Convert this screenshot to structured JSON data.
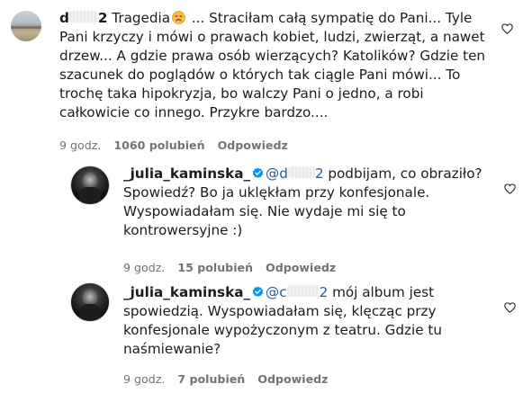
{
  "comments": [
    {
      "username_visible_start": "d",
      "username_visible_end": "2",
      "text_line1": " Tragedia",
      "text_line1_after": " ... Straciłam całą sympatię do Pani... Tyle",
      "text_rest": "Pani krzyczy i mówi o prawach kobiet, ludzi, zwierząt, a nawet\ndrzew... A gdzie prawa osób wierzących? Katolików? Gdzie ten\nszacunek do poglądów o których tak ciągle Pani mówi... To\ntrochę taka hipokryzja, bo walczy Pani o jedno, a robi\ncałkowicie co innego. Przykre bardzo....",
      "time": "9 godz.",
      "likes": "1060 polubień",
      "reply": "Odpowiedz"
    },
    {
      "username": "_julia_kaminska_",
      "mention_start": "@d",
      "mention_end": "2",
      "text_line1": " podbijam, co obraziło?",
      "text_rest": "Spowiedź? Bo ja uklękłam przy konfesjonale.\nWyspowiadałam się. Nie wydaje mi się to\nkontrowersyjne :)",
      "time": "9 godz.",
      "likes": "15 polubień",
      "reply": "Odpowiedz"
    },
    {
      "username": "_julia_kaminska_",
      "mention_start": "@c",
      "mention_end": "2",
      "text_line1": " mój album jest",
      "text_rest": "spowiedzią. Wyspowiadałam się, klęcząc przy\nkonfesjonale wypożyczonym z teatru. Gdzie tu\nnaśmiewanie?",
      "time": "9 godz.",
      "likes": "7 polubień",
      "reply": "Odpowiedz"
    }
  ],
  "icons": {
    "like": "heart-outline-icon",
    "verified": "verified-badge-icon",
    "emoji": "disappointed-face-emoji"
  },
  "colors": {
    "meta_gray": "#737373",
    "mention_blue": "#2a5b8c",
    "verified_blue": "#0095f6"
  }
}
